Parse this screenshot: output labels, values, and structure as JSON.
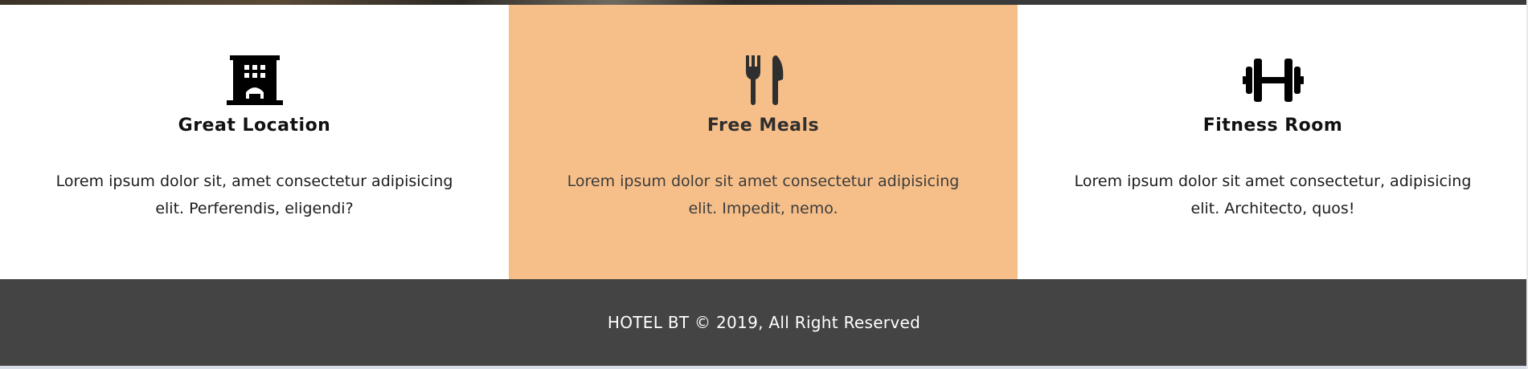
{
  "colors": {
    "highlight_background": "#f6bf89",
    "footer_background": "#444444",
    "footer_text": "#ffffff"
  },
  "features": [
    {
      "icon": "building-icon",
      "title": "Great Location",
      "text": "Lorem ipsum dolor sit, amet consectetur adipisicing elit. Perferendis, eligendi?"
    },
    {
      "icon": "fork-knife-icon",
      "title": "Free Meals",
      "text": "Lorem ipsum dolor sit amet consectetur adipisicing elit. Impedit, nemo."
    },
    {
      "icon": "dumbbell-icon",
      "title": "Fitness Room",
      "text": "Lorem ipsum dolor sit amet consectetur, adipisicing elit. Architecto, quos!"
    }
  ],
  "footer": {
    "copyright": "HOTEL BT © 2019, All Right Reserved"
  }
}
